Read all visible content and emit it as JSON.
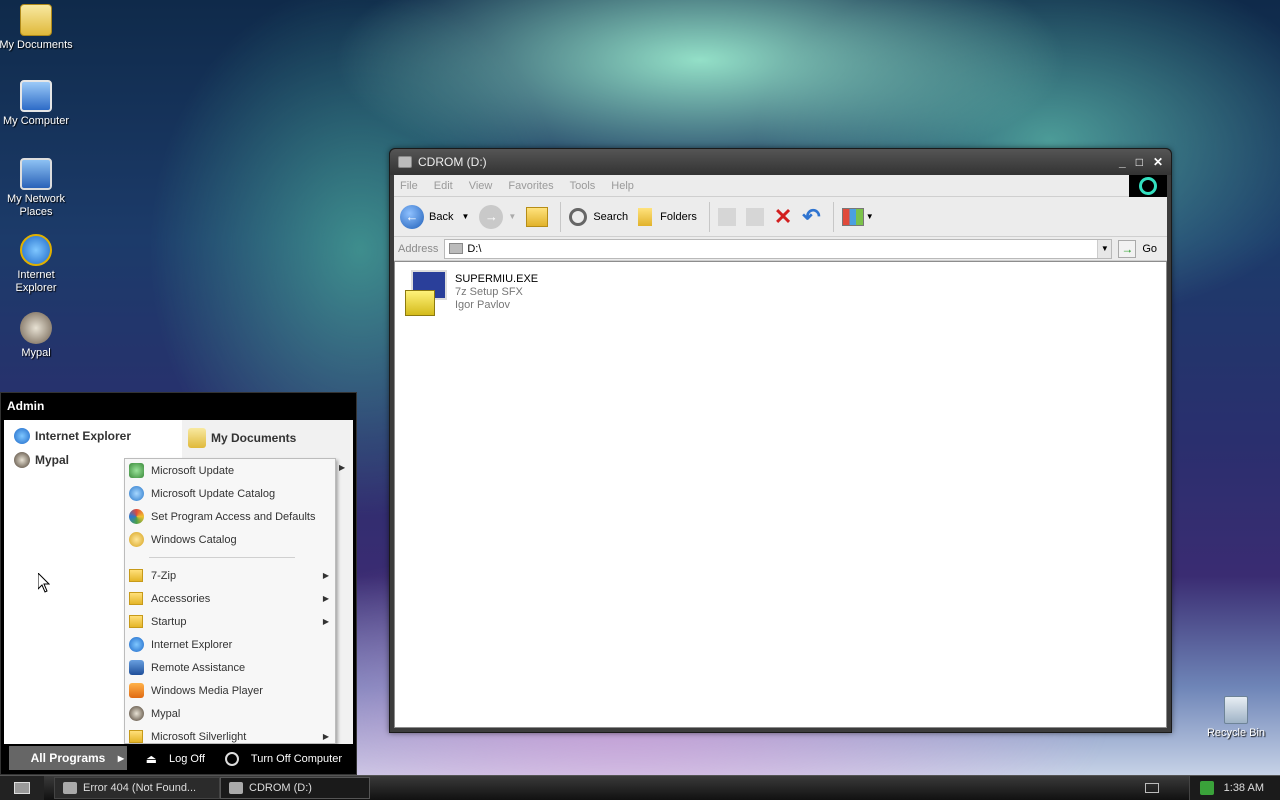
{
  "desktop": {
    "icons": [
      {
        "label": "My Documents"
      },
      {
        "label": "My Computer"
      },
      {
        "label": "My Network Places"
      },
      {
        "label": "Internet Explorer"
      },
      {
        "label": "Mypal"
      }
    ],
    "recycle_bin": "Recycle Bin"
  },
  "window": {
    "title": "CDROM (D:)",
    "controls": {
      "minimize": "_",
      "maximize": "□",
      "close": "✕"
    },
    "menu": [
      "File",
      "Edit",
      "View",
      "Favorites",
      "Tools",
      "Help"
    ],
    "toolbar": {
      "back": "Back",
      "search": "Search",
      "folders": "Folders"
    },
    "address": {
      "label": "Address",
      "value": "D:\\",
      "go": "Go"
    },
    "file": {
      "name": "SUPERMIU.EXE",
      "type": "7z Setup SFX",
      "author": "Igor Pavlov"
    }
  },
  "start_menu": {
    "user": "Admin",
    "pinned": [
      "Internet Explorer",
      "Mypal"
    ],
    "right_items": [
      "My Documents"
    ],
    "all_programs": "All Programs",
    "log_off": "Log Off",
    "turn_off": "Turn Off Computer"
  },
  "programs": {
    "top": [
      "Microsoft Update",
      "Microsoft Update Catalog",
      "Set Program Access and Defaults",
      "Windows Catalog"
    ],
    "list": [
      {
        "label": "7-Zip",
        "submenu": true
      },
      {
        "label": "Accessories",
        "submenu": true
      },
      {
        "label": "Startup",
        "submenu": true
      },
      {
        "label": "Internet Explorer",
        "submenu": false
      },
      {
        "label": "Remote Assistance",
        "submenu": false
      },
      {
        "label": "Windows Media Player",
        "submenu": false
      },
      {
        "label": "Mypal",
        "submenu": false
      },
      {
        "label": "Microsoft Silverlight",
        "submenu": true
      }
    ]
  },
  "taskbar": {
    "tasks": [
      "Error 404 (Not Found...",
      "CDROM (D:)"
    ],
    "clock": "1:38 AM"
  }
}
